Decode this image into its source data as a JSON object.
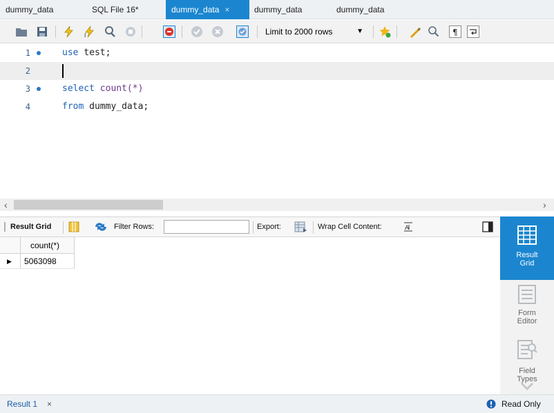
{
  "tabs": [
    {
      "label": "dummy_data",
      "active": false
    },
    {
      "label": "SQL File 16*",
      "active": false
    },
    {
      "label": "dummy_data",
      "active": true,
      "close": "×"
    },
    {
      "label": "dummy_data",
      "active": false
    },
    {
      "label": "dummy_data",
      "active": false
    }
  ],
  "toolbar": {
    "limit_label": "Limit to 2000 rows",
    "icons": [
      "open-folder-icon",
      "save-icon",
      "execute-icon",
      "execute-current-icon",
      "explain-icon",
      "stop-icon",
      "toggle-error-stop-icon",
      "commit-icon",
      "rollback-icon",
      "autocommit-icon",
      "limit-dropdown",
      "bookmark-icon",
      "beautify-icon",
      "find-icon",
      "invisible-chars-icon",
      "wrap-icon"
    ]
  },
  "editor": {
    "lines": [
      {
        "num": "1",
        "marker": true,
        "tokens": [
          {
            "t": "use",
            "c": "kw"
          },
          {
            "t": " test;",
            "c": "plain"
          }
        ]
      },
      {
        "num": "2",
        "marker": false,
        "current": true,
        "tokens": []
      },
      {
        "num": "3",
        "marker": true,
        "tokens": [
          {
            "t": "select",
            "c": "kw"
          },
          {
            "t": " count(*)",
            "c": "fn"
          }
        ]
      },
      {
        "num": "4",
        "marker": false,
        "tokens": [
          {
            "t": "from",
            "c": "kw"
          },
          {
            "t": " dummy_data;",
            "c": "plain"
          }
        ]
      }
    ]
  },
  "result_toolbar": {
    "result_grid": "Result Grid",
    "filter_rows": "Filter Rows:",
    "filter_value": "",
    "export": "Export:",
    "wrap_cell": "Wrap Cell Content:"
  },
  "grid": {
    "columns": [
      "count(*)"
    ],
    "rows": [
      [
        "5063098"
      ]
    ]
  },
  "side_panel": [
    {
      "label_1": "Result",
      "label_2": "Grid",
      "icon": "result-grid-icon",
      "active": true
    },
    {
      "label_1": "Form",
      "label_2": "Editor",
      "icon": "form-editor-icon",
      "active": false
    },
    {
      "label_1": "Field",
      "label_2": "Types",
      "icon": "field-types-icon",
      "active": false
    }
  ],
  "status": {
    "result_tab": "Result 1",
    "close": "×",
    "read_only": "Read Only"
  },
  "colors": {
    "accent": "#1b86cf",
    "keyword": "#1d62b4",
    "function": "#6d3c8a",
    "line_number": "#3a5f8a"
  }
}
